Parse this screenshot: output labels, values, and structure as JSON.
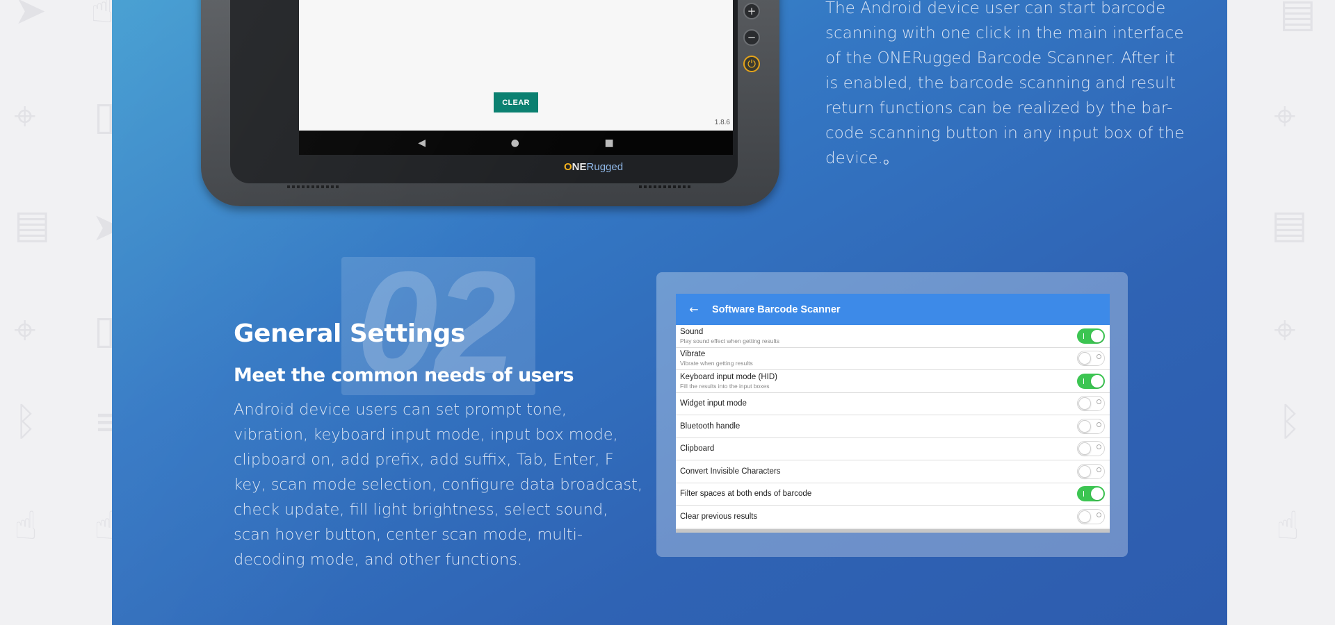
{
  "background_icons": [
    "send-icon",
    "hand-pointer-icon",
    "battery-icon",
    "location-pin-icon",
    "document-icon",
    "bluetooth-icon",
    "menu-icon"
  ],
  "tablet": {
    "clear_label": "CLEAR",
    "version": "1.8.6",
    "brand_o": "O",
    "brand_ne": "NE",
    "brand_rugged": "Rugged",
    "nav_back": "◀",
    "nav_home": "●",
    "nav_recent": "■",
    "side_plus": "+",
    "side_minus": "−",
    "side_power": "⏻"
  },
  "intro": {
    "text": "The Android device user can start barcode scanning with one click in the main interface of the ONERugged Barcode Scanner. After it is enabled, the barcode scanning and result return functions can be realized by the bar-code scanning button in any input box of the device.。"
  },
  "section": {
    "number": "02",
    "title": "General Settings",
    "subtitle": "Meet the common needs of users",
    "body": "Android device users can set prompt tone, vibration, keyboard input mode, input box mode, clipboard on, add prefix, add suffix, Tab, Enter, F key, scan mode selection, configure data broadcast, check update, fill light brightness, select sound, scan hover button, center scan mode, multi-decoding mode, and other functions."
  },
  "settings_app": {
    "back_icon": "←",
    "title": "Software Barcode Scanner",
    "rows": [
      {
        "label": "Sound",
        "desc": "Play sound effect when getting results",
        "on": true
      },
      {
        "label": "Vibrate",
        "desc": "Vibrate when getting results",
        "on": false
      },
      {
        "label": "Keyboard input mode (HID)",
        "desc": "Fill the results into the input boxes",
        "on": true
      },
      {
        "label": "Widget input mode",
        "desc": "",
        "on": false
      },
      {
        "label": "Bluetooth handle",
        "desc": "",
        "on": false
      },
      {
        "label": "Clipboard",
        "desc": "",
        "on": false
      },
      {
        "label": "Convert Invisible Characters",
        "desc": "",
        "on": false
      },
      {
        "label": "Filter spaces at both ends of barcode",
        "desc": "",
        "on": true
      },
      {
        "label": "Clear previous results",
        "desc": "",
        "on": false
      }
    ]
  }
}
